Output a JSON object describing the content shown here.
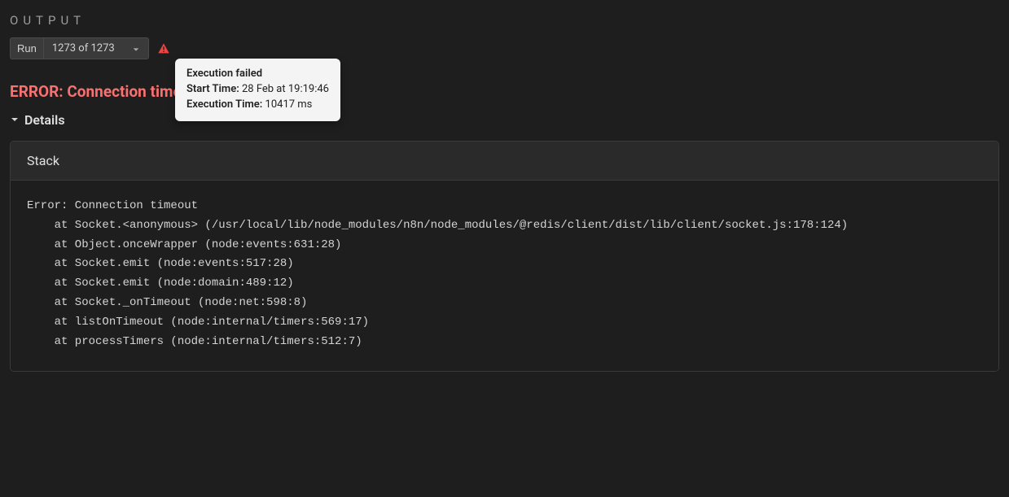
{
  "header": {
    "title": "OUTPUT"
  },
  "controls": {
    "run_label": "Run",
    "run_value": "1273 of 1273"
  },
  "tooltip": {
    "title": "Execution failed",
    "start_label": "Start Time:",
    "start_value": "28 Feb at 19:19:46",
    "exec_label": "Execution Time:",
    "exec_value": "10417 ms"
  },
  "error": {
    "title": "ERROR: Connection timeout"
  },
  "details": {
    "label": "Details"
  },
  "stack": {
    "header": "Stack",
    "body": "Error: Connection timeout\n    at Socket.<anonymous> (/usr/local/lib/node_modules/n8n/node_modules/@redis/client/dist/lib/client/socket.js:178:124)\n    at Object.onceWrapper (node:events:631:28)\n    at Socket.emit (node:events:517:28)\n    at Socket.emit (node:domain:489:12)\n    at Socket._onTimeout (node:net:598:8)\n    at listOnTimeout (node:internal/timers:569:17)\n    at processTimers (node:internal/timers:512:7)"
  }
}
